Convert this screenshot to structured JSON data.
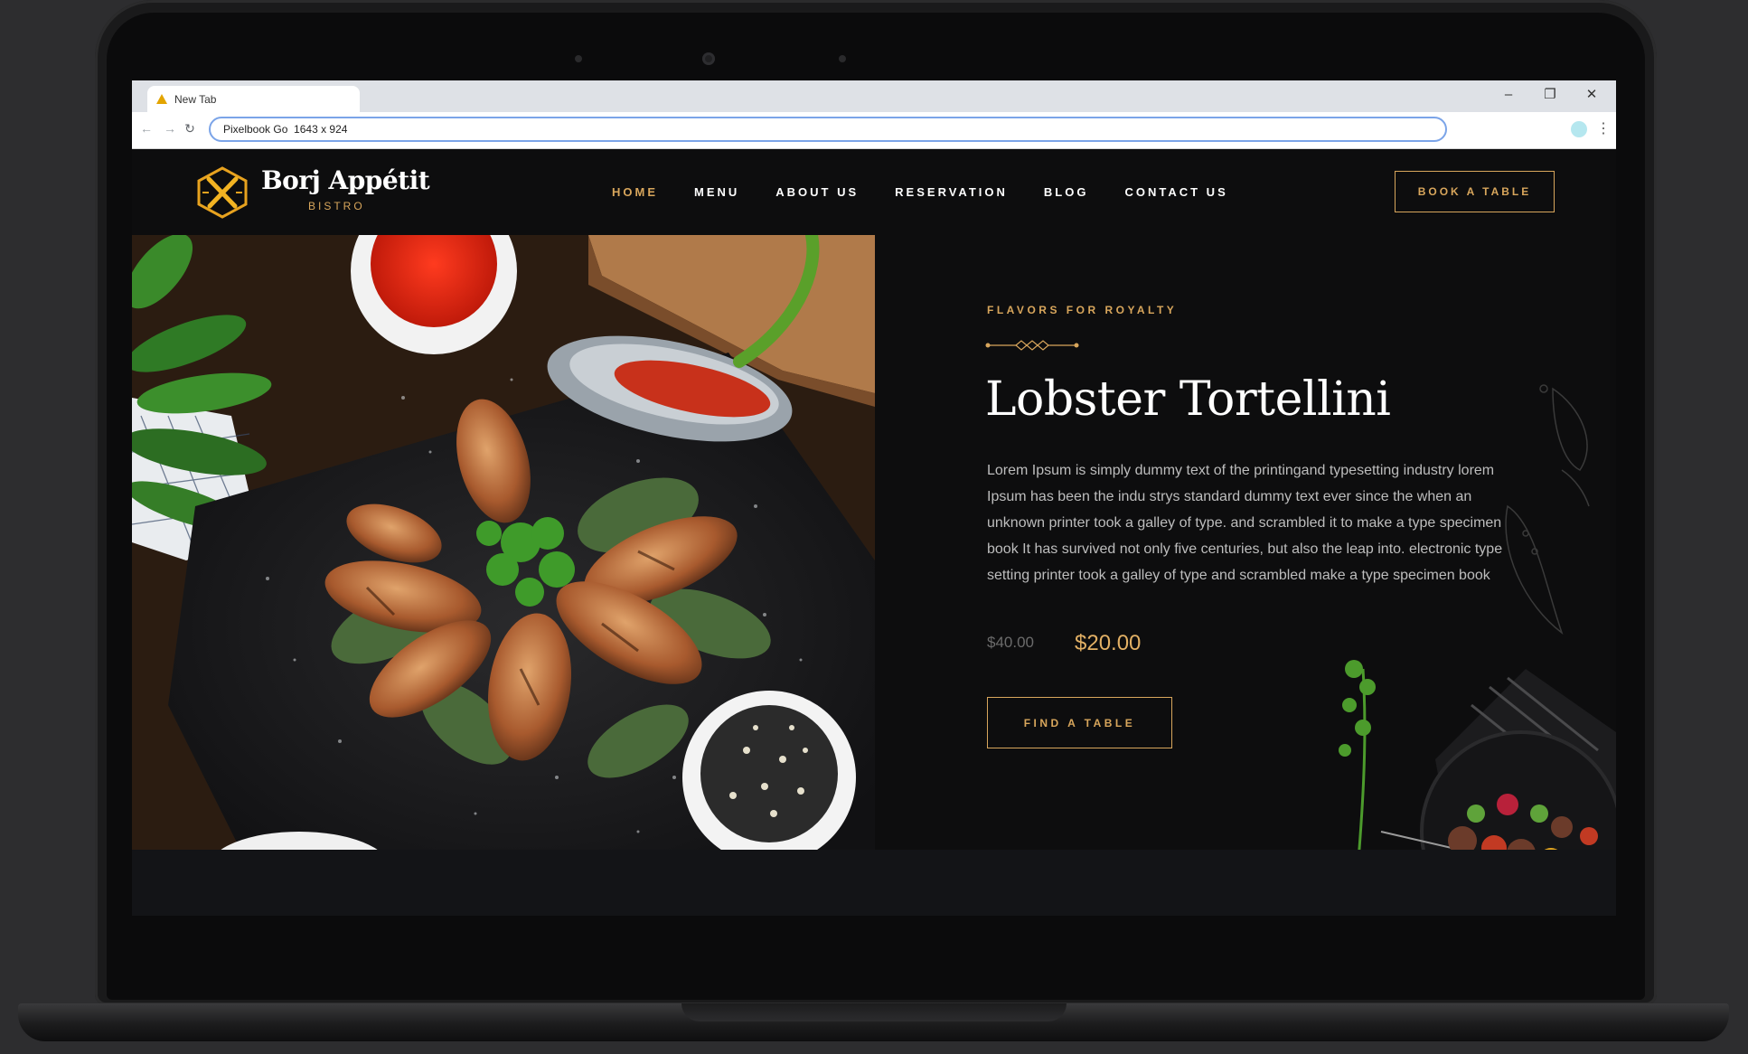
{
  "browser": {
    "tab_title": "New Tab",
    "address": "Pixelbook Go  1643 x 924",
    "minimize": "–",
    "maximize": "❐",
    "close": "✕",
    "back": "←",
    "forward": "→",
    "reload": "↻",
    "menu": "⋮"
  },
  "brand": {
    "name": "Borj Appétit",
    "tagline": "BISTRO",
    "accent_color": "#d8a65c"
  },
  "nav": {
    "items": [
      {
        "label": "HOME",
        "active": true
      },
      {
        "label": "MENU",
        "active": false
      },
      {
        "label": "ABOUT US",
        "active": false
      },
      {
        "label": "RESERVATION",
        "active": false
      },
      {
        "label": "BLOG",
        "active": false
      },
      {
        "label": "CONTACT US",
        "active": false
      }
    ],
    "cta": "BOOK A TABLE"
  },
  "hero": {
    "eyebrow": "FLAVORS FOR ROYALTY",
    "title": "Lobster Tortellini",
    "description": "Lorem Ipsum is simply dummy text of the printingand typesetting industry lorem Ipsum has been the indu strys standard dummy text ever since the when an unknown printer took a galley of type. and scrambled it to make a type specimen book It has survived not only five centuries, but also the leap into. electronic type setting printer took a galley of type and scrambled make a type specimen book",
    "old_price": "$40.00",
    "price": "$20.00",
    "cta": "FIND A TABLE"
  }
}
